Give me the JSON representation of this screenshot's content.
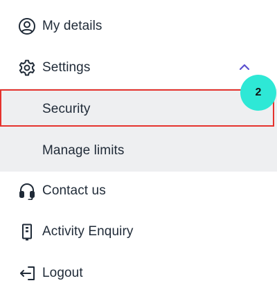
{
  "menu": {
    "items": [
      {
        "label": "My details",
        "icon": "user-circle-icon"
      },
      {
        "label": "Settings",
        "icon": "gear-icon"
      },
      {
        "label": "Security",
        "icon": ""
      },
      {
        "label": "Manage limits",
        "icon": ""
      },
      {
        "label": "Contact us",
        "icon": "headset-icon"
      },
      {
        "label": "Activity Enquiry",
        "icon": "document-icon"
      },
      {
        "label": "Logout",
        "icon": "logout-icon"
      }
    ]
  },
  "annotation": {
    "badge_label": "2",
    "badge_color": "#2ee8d6",
    "highlight_color": "#e5322d"
  },
  "colors": {
    "chevron": "#5b4fcf",
    "submenu_bg": "#eeeff1"
  }
}
